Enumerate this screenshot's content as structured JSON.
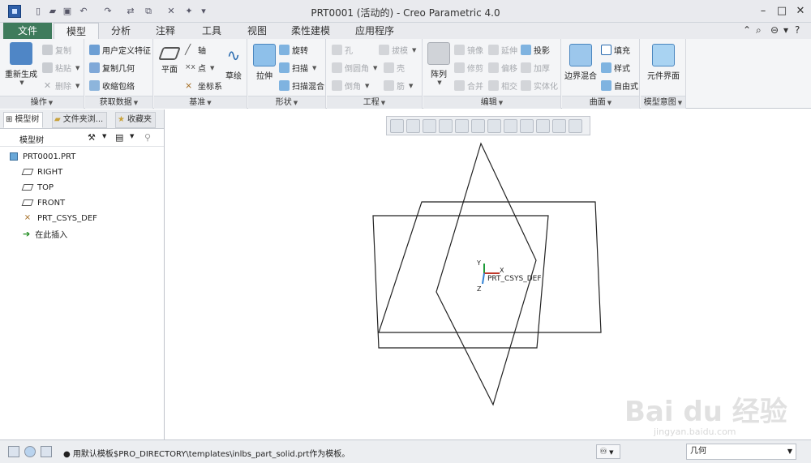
{
  "window": {
    "title": "PRT0001 (活动的) - Creo Parametric 4.0",
    "controls": {
      "minimize": "–",
      "maximize": "□",
      "close": "✕"
    }
  },
  "tabs": {
    "file": "文件",
    "items": [
      "模型",
      "分析",
      "注释",
      "工具",
      "视图",
      "柔性建模",
      "应用程序"
    ],
    "active": "模型"
  },
  "ribbon": {
    "groups": {
      "operations": {
        "label": "操作",
        "regenerate": "重新生成",
        "copy": "复制",
        "paste": "粘贴",
        "delete": "删除"
      },
      "get_data": {
        "label": "获取数据",
        "udf": "用户定义特征",
        "copy_geometry": "复制几何",
        "shrinkwrap": "收缩包络"
      },
      "datum": {
        "label": "基准",
        "plane": "平面",
        "axis": "轴",
        "point": "点",
        "csys": "坐标系",
        "sketch": "草绘"
      },
      "shapes": {
        "label": "形状",
        "extrude": "拉伸",
        "revolve": "旋转",
        "sweep": "扫描",
        "swept_blend": "扫描混合"
      },
      "engineering": {
        "label": "工程",
        "hole": "孔",
        "draft": "拔模",
        "round": "倒圆角",
        "shell": "壳",
        "chamfer": "倒角",
        "rib": "筋"
      },
      "editing": {
        "label": "编辑",
        "pattern": "阵列",
        "mirror": "镜像",
        "extend": "延伸",
        "project": "投影",
        "trim": "修剪",
        "offset": "偏移",
        "thicken": "加厚",
        "merge": "合并",
        "intersect": "相交",
        "solidify": "实体化"
      },
      "surfaces": {
        "label": "曲面",
        "boundary_blend": "边界混合",
        "fill": "填充",
        "style": "样式",
        "freestyle": "自由式"
      },
      "model_intent": {
        "label": "模型意图",
        "component_interface": "元件界面"
      }
    }
  },
  "left_panel": {
    "tabs": [
      "模型树",
      "文件夹浏...",
      "收藏夹"
    ],
    "tree_heading": "模型树",
    "tree": [
      {
        "label": "PRT0001.PRT",
        "icon": "part-icon"
      },
      {
        "label": "RIGHT",
        "icon": "datum-plane-icon"
      },
      {
        "label": "TOP",
        "icon": "datum-plane-icon"
      },
      {
        "label": "FRONT",
        "icon": "datum-plane-icon"
      },
      {
        "label": "PRT_CSYS_DEF",
        "icon": "csys-icon"
      },
      {
        "label": "在此插入",
        "icon": "insert-arrow-icon"
      }
    ]
  },
  "graphics": {
    "csys_label": "PRT_CSYS_DEF",
    "axis_x": "X",
    "axis_y": "Y",
    "axis_z": "Z"
  },
  "status": {
    "message": "● 用默认模板$PRO_DIRECTORY\\templates\\inlbs_part_solid.prt作为模板。",
    "filter": "几何"
  },
  "watermark": {
    "text": "Bai du 经验",
    "sub": "jingyan.baidu.com"
  },
  "colors": {
    "file_tab": "#3f7b5c",
    "ribbon_bg": "#f4f5f7",
    "line": "#222222"
  }
}
